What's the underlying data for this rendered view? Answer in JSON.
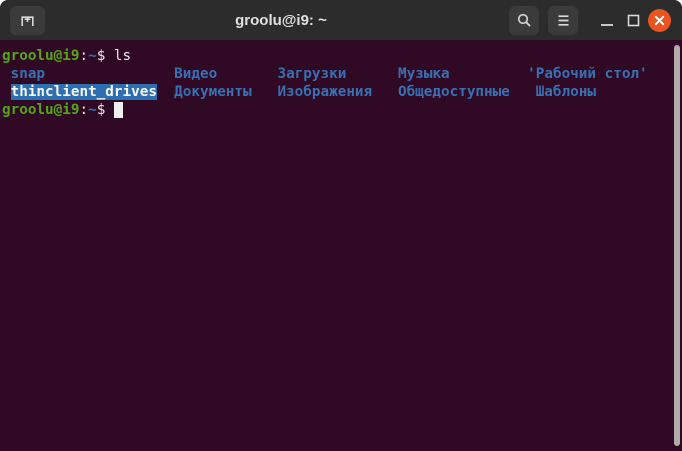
{
  "header": {
    "title": "groolu@i9: ~",
    "buttons": [
      {
        "name": "new-tab",
        "icon": "tab-new-icon"
      },
      {
        "name": "search",
        "icon": "search-icon"
      },
      {
        "name": "menu",
        "icon": "hamburger-menu-icon"
      },
      {
        "name": "minimize",
        "icon": "minimize-icon"
      },
      {
        "name": "maximize",
        "icon": "maximize-icon"
      },
      {
        "name": "close",
        "icon": "close-x-icon"
      }
    ]
  },
  "colors": {
    "terminal_background": "#300a24",
    "prompt_green": "#55a515",
    "directory_blue": "#3770b4",
    "selection_blue": "#2d6fb2",
    "close_orange": "#e95420",
    "header_gray": "#2c2c2c",
    "scrollbar_gray": "#bcbab8"
  },
  "terminal": {
    "lines": [
      {
        "segments": [
          {
            "text": "groolu@i9",
            "style": "prompt",
            "name": "prompt-user-host"
          },
          {
            "text": ":",
            "style": "fg"
          },
          {
            "text": "~",
            "style": "path",
            "name": "prompt-path"
          },
          {
            "text": "$ ",
            "style": "fg"
          },
          {
            "text": "ls",
            "style": "fg",
            "name": "command-text"
          }
        ]
      },
      {
        "segments": [
          {
            "text": " ",
            "style": "fg"
          },
          {
            "text": "snap",
            "style": "dir",
            "name": "dir-name"
          },
          {
            "text": "               ",
            "style": "fg"
          },
          {
            "text": "Видео",
            "style": "dir",
            "name": "dir-name"
          },
          {
            "text": "       ",
            "style": "fg"
          },
          {
            "text": "Загрузки",
            "style": "dir",
            "name": "dir-name"
          },
          {
            "text": "      ",
            "style": "fg"
          },
          {
            "text": "Музыка",
            "style": "dir",
            "name": "dir-name"
          },
          {
            "text": "         ",
            "style": "fg"
          },
          {
            "text": "'Рабочий стол'",
            "style": "dir",
            "name": "dir-name"
          }
        ]
      },
      {
        "segments": [
          {
            "text": " ",
            "style": "fg"
          },
          {
            "text": "thinclient_drives",
            "style": "selected",
            "name": "selected-dir-name"
          },
          {
            "text": "  ",
            "style": "fg"
          },
          {
            "text": "Документы",
            "style": "dir",
            "name": "dir-name"
          },
          {
            "text": "   ",
            "style": "fg"
          },
          {
            "text": "Изображения",
            "style": "dir",
            "name": "dir-name"
          },
          {
            "text": "   ",
            "style": "fg"
          },
          {
            "text": "Общедоступные",
            "style": "dir",
            "name": "dir-name"
          },
          {
            "text": "   ",
            "style": "fg"
          },
          {
            "text": "Шаблоны",
            "style": "dir",
            "name": "dir-name"
          }
        ]
      },
      {
        "segments": [
          {
            "text": "groolu@i9",
            "style": "prompt",
            "name": "prompt-user-host"
          },
          {
            "text": ":",
            "style": "fg"
          },
          {
            "text": "~",
            "style": "path",
            "name": "prompt-path"
          },
          {
            "text": "$ ",
            "style": "fg"
          },
          {
            "text": " ",
            "style": "cursor",
            "name": "terminal-cursor"
          }
        ]
      }
    ]
  }
}
